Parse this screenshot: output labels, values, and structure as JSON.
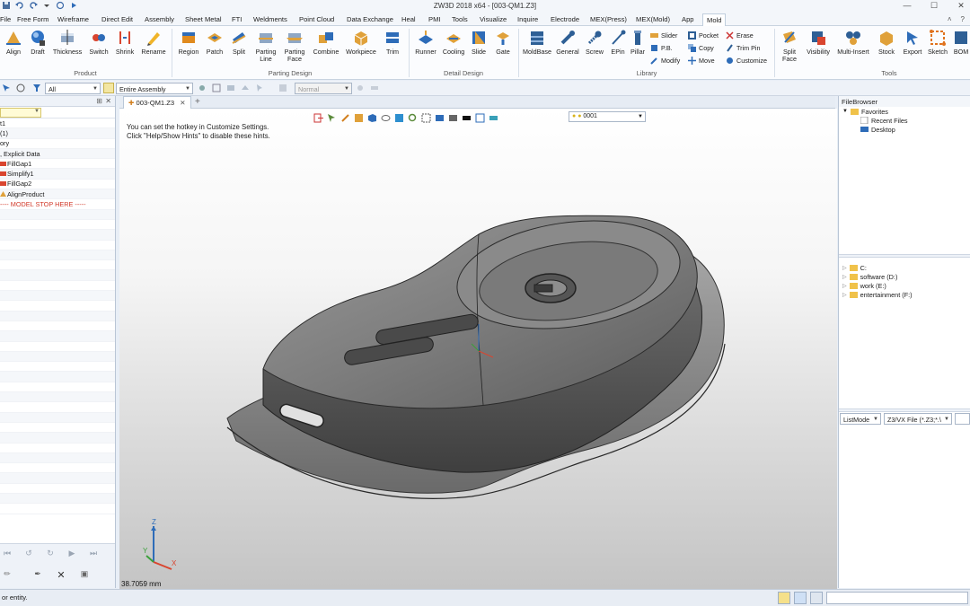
{
  "window": {
    "title": "ZW3D 2018 x64 - [003-QM1.Z3]",
    "controls": [
      "minimize",
      "maximize",
      "close"
    ]
  },
  "menu": {
    "tabs": [
      "File",
      "Free Form",
      "Wireframe",
      "Direct Edit",
      "Assembly",
      "Sheet Metal",
      "FTI",
      "Weldments",
      "Point Cloud",
      "Data Exchange",
      "Heal",
      "PMI",
      "Tools",
      "Visualize",
      "Inquire",
      "Electrode",
      "MEX(Press)",
      "MEX(Mold)",
      "App",
      "Mold"
    ],
    "active": "Mold"
  },
  "ribbon": {
    "product": {
      "label": "Product",
      "buttons": [
        "Align",
        "Draft",
        "Thickness",
        "Switch",
        "Shrink",
        "Rename"
      ]
    },
    "parting": {
      "label": "Parting Design",
      "buttons": [
        "Region",
        "Patch",
        "Split",
        "Parting Line",
        "Parting Face",
        "Combine",
        "Workpiece",
        "Trim"
      ]
    },
    "detail": {
      "label": "Detail Design",
      "buttons": [
        "Runner",
        "Cooling",
        "Slide",
        "Gate"
      ]
    },
    "library": {
      "label": "Library",
      "buttons": [
        "MoldBase",
        "General",
        "Screw",
        "EPin",
        "Pillar"
      ],
      "small": [
        "Slider",
        "P.B.",
        "Modify",
        "Pocket",
        "Copy",
        "Move",
        "Erase",
        "Trim Pin",
        "Customize"
      ]
    },
    "tools": {
      "label": "Tools",
      "buttons": [
        "Split Face",
        "Visibility",
        "Multi-Insert",
        "Stock",
        "Export",
        "Sketch",
        "BOM"
      ]
    }
  },
  "filterbar": {
    "filter": "All",
    "scope": "Entire Assembly",
    "render_mode": "Normal"
  },
  "history": {
    "rows": [
      "t1",
      "(1)",
      "ory",
      ", Explicit Data",
      "FillGap1",
      "Simplify1",
      "FillGap2",
      "AlignProduct",
      "---- MODEL STOP HERE -----"
    ]
  },
  "viewport": {
    "tab": "003-QM1.Z3",
    "hint_line1": "You can set the hotkey in Customize Settings.",
    "hint_line2": "Click \"Help/Show Hints\" to disable these hints.",
    "layer": "0001",
    "measure": "38.7059 mm",
    "axis_labels": [
      "Z",
      "Y",
      "X"
    ]
  },
  "filebrowser": {
    "title": "FileBrowser",
    "favorites": [
      "Favorites",
      "Recent Files",
      "Desktop"
    ],
    "drives": [
      "C:",
      "software (D:)",
      "work (E:)",
      "entertainment (F:)"
    ],
    "list_mode": "ListMode",
    "file_filter": "Z3/VX File (*.Z3;*.\\"
  },
  "statusbar": {
    "prompt": "or entity."
  },
  "colors": {
    "accent": "#2e6cb8",
    "ribbon_bg": "#fbfcfe",
    "model_gray": "#6e6e6e",
    "stop_red": "#d23a2a"
  }
}
